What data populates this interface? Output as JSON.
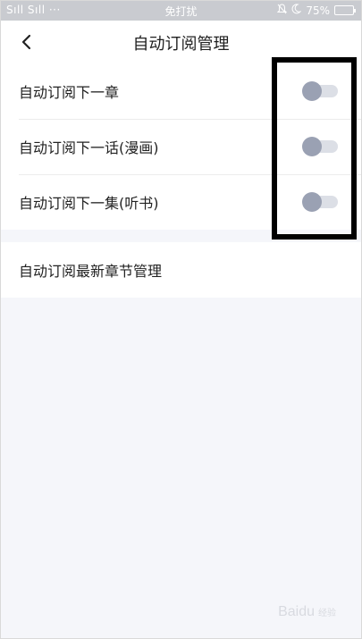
{
  "status_bar": {
    "signal": "Sıll Sıll ···",
    "mode": "免打扰",
    "battery": "75%",
    "battery_level": 0.75
  },
  "header": {
    "title": "自动订阅管理",
    "back_icon": "chevron-left-icon"
  },
  "settings": [
    {
      "label": "自动订阅下一章",
      "enabled": false
    },
    {
      "label": "自动订阅下一话(漫画)",
      "enabled": false
    },
    {
      "label": "自动订阅下一集(听书)",
      "enabled": false
    }
  ],
  "manage": {
    "label": "自动订阅最新章节管理"
  },
  "watermark": {
    "brand": "Baidu",
    "sub": "经验"
  },
  "colors": {
    "background": "#f5f6fa",
    "toggle_thumb_off": "#9aa1b3",
    "toggle_track_off": "#dcdfe6",
    "highlight_box": "#000000"
  }
}
